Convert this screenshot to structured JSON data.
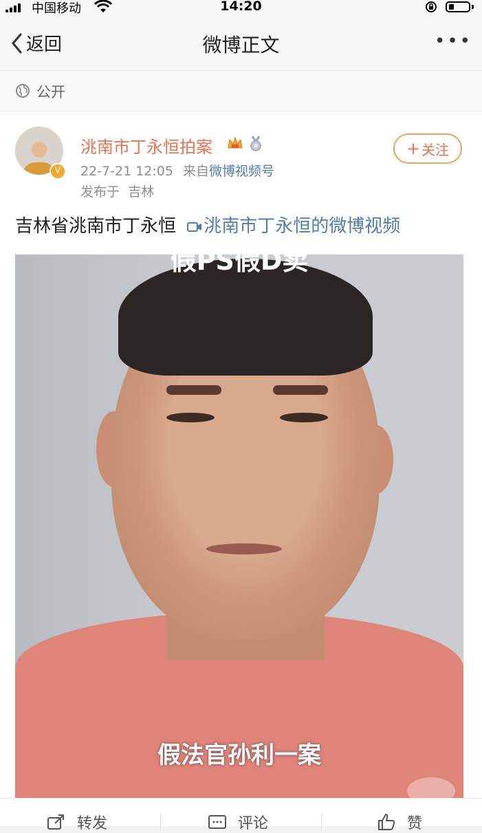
{
  "status_bar": {
    "carrier": "中国移动",
    "time": "14:20"
  },
  "nav": {
    "back_label": "返回",
    "title": "微博正文"
  },
  "visibility": {
    "label": "公开"
  },
  "post": {
    "author": "洮南市丁永恒拍案",
    "date": "22-7-21 12:05",
    "source_prefix": "来自",
    "source": "微博视频号",
    "location_prefix": "发布于",
    "location": "吉林",
    "follow_label": "关注",
    "text": "吉林省洮南市丁永恒",
    "video_link": "洮南市丁永恒的微博视频"
  },
  "video": {
    "caption_top": "假PS假D卖",
    "caption": "假法官孙利一案"
  },
  "actions": {
    "repost": "转发",
    "comment": "评论",
    "like": "赞"
  },
  "colors": {
    "accent": "#eb7350",
    "link": "#507daf"
  }
}
